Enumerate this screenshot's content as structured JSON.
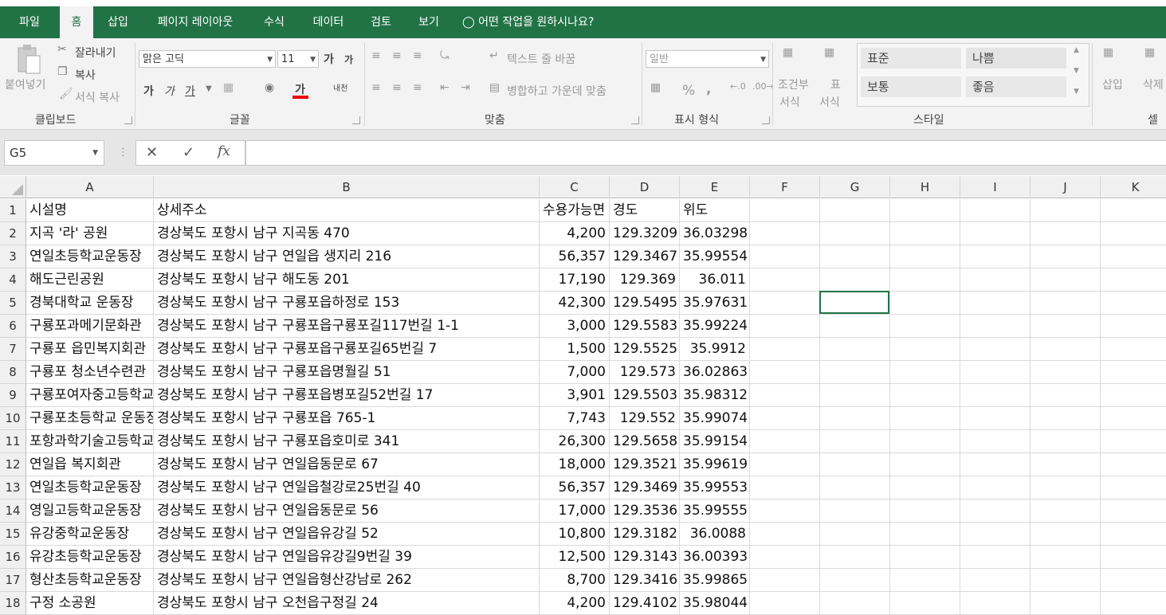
{
  "menu": {
    "tabs": [
      "파일",
      "홈",
      "삽입",
      "페이지 레이아웃",
      "수식",
      "데이터",
      "검토",
      "보기"
    ],
    "active_tab": "홈",
    "tell_me": "어떤 작업을 원하시나요?"
  },
  "ribbon": {
    "clipboard": {
      "paste": "붙여넣기",
      "cut": "잘라내기",
      "copy": "복사",
      "format_painter": "서식 복사",
      "label": "클립보드"
    },
    "font": {
      "name": "맑은 고딕",
      "size": "11",
      "grow": "가",
      "shrink": "가",
      "bold": "가",
      "italic": "가",
      "underline": "가",
      "font_color": "가",
      "phonetic": "내천",
      "label": "글꼴"
    },
    "alignment": {
      "wrap_text": "텍스트 줄 바꿈",
      "merge_center": "병합하고 가운데 맞춤",
      "label": "맞춤"
    },
    "number": {
      "format": "일반",
      "percent": "%",
      "comma": ",",
      "label": "표시 형식"
    },
    "styles": {
      "conditional_1": "조건부",
      "conditional_2": "서식",
      "table_1": "표",
      "table_2": "서식",
      "normal": "표준",
      "bad": "나쁨",
      "neutral": "보통",
      "good": "좋음",
      "label": "스타일"
    },
    "cells": {
      "insert": "삽입",
      "delete": "삭제",
      "label": "셀"
    }
  },
  "formula_bar": {
    "name_box": "G5",
    "formula": "",
    "fx": "fx"
  },
  "sheet": {
    "columns": [
      "A",
      "B",
      "C",
      "D",
      "E",
      "F",
      "G",
      "H",
      "I",
      "J",
      "K"
    ],
    "rows": [
      [
        "1",
        "시설명",
        "상세주소",
        "수용가능면",
        "경도",
        "위도"
      ],
      [
        "2",
        "지곡 '라' 공원",
        "경상북도 포항시 남구 지곡동    470",
        "4,200",
        "129.3209",
        "36.03298"
      ],
      [
        "3",
        "연일초등학교운동장",
        "경상북도 포항시 남구 연일읍 생지리 216",
        "56,357",
        "129.3467",
        "35.99554"
      ],
      [
        "4",
        "해도근린공원",
        "경상북도 포항시 남구 해도동    201",
        "17,190",
        "129.369",
        "36.011"
      ],
      [
        "5",
        "경북대학교 운동장",
        "경상북도 포항시 남구 구룡포읍하정로 153",
        "42,300",
        "129.5495",
        "35.97631"
      ],
      [
        "6",
        "구룡포과메기문화관",
        "경상북도 포항시 남구 구룡포읍구룡포길117번길 1-1",
        "3,000",
        "129.5583",
        "35.99224"
      ],
      [
        "7",
        "구룡포 읍민복지회관",
        "경상북도 포항시 남구 구룡포읍구룡포길65번길 7",
        "1,500",
        "129.5525",
        "35.9912"
      ],
      [
        "8",
        "구룡포 청소년수련관",
        "경상북도 포항시 남구 구룡포읍명월길 51",
        "7,000",
        "129.573",
        "36.02863"
      ],
      [
        "9",
        "구룡포여자중고등학교",
        "경상북도 포항시 남구 구룡포읍병포길52번길 17",
        "3,901",
        "129.5503",
        "35.98312"
      ],
      [
        "10",
        "구룡포초등학교 운동장",
        "경상북도 포항시 남구 구룡포읍    765-1",
        "7,743",
        "129.552",
        "35.99074"
      ],
      [
        "11",
        "포항과학기술고등학교",
        "경상북도 포항시 남구 구룡포읍호미로 341",
        "26,300",
        "129.5658",
        "35.99154"
      ],
      [
        "12",
        "연일읍 복지회관",
        "경상북도 포항시 남구 연일읍동문로 67",
        "18,000",
        "129.3521",
        "35.99619"
      ],
      [
        "13",
        "연일초등학교운동장",
        "경상북도 포항시 남구 연일읍철강로25번길 40",
        "56,357",
        "129.3469",
        "35.99553"
      ],
      [
        "14",
        "영일고등학교운동장",
        "경상북도 포항시 남구 연일읍동문로 56",
        "17,000",
        "129.3536",
        "35.99555"
      ],
      [
        "15",
        "유강중학교운동장",
        "경상북도 포항시 남구 연일읍유강길 52",
        "10,800",
        "129.3182",
        "36.0088"
      ],
      [
        "16",
        "유강초등학교운동장",
        "경상북도 포항시 남구 연일읍유강길9번길 39",
        "12,500",
        "129.3143",
        "36.00393"
      ],
      [
        "17",
        "형산초등학교운동장",
        "경상북도 포항시 남구 연일읍형산강남로 262",
        "8,700",
        "129.3416",
        "35.99865"
      ],
      [
        "18",
        "구정 소공원",
        "경상북도 포항시 남구 오천읍구정길 24",
        "4,200",
        "129.4102",
        "35.98044"
      ]
    ]
  }
}
